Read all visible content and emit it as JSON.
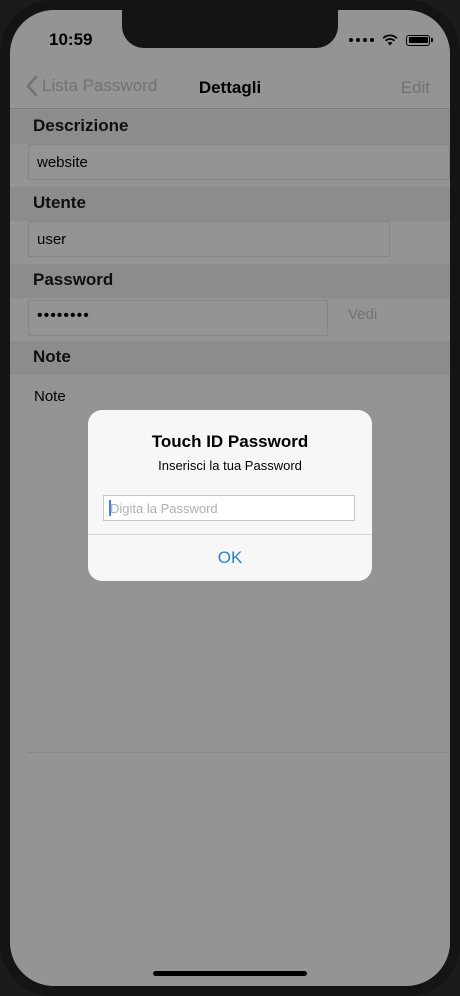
{
  "status": {
    "time": "10:59"
  },
  "nav": {
    "back_label": "Lista Password",
    "title": "Dettagli",
    "edit_label": "Edit"
  },
  "sections": {
    "description": {
      "label": "Descrizione",
      "value": "website"
    },
    "user": {
      "label": "Utente",
      "value": "user"
    },
    "password": {
      "label": "Password",
      "value": "••••••••",
      "show_label": "Vedi"
    },
    "note": {
      "label": "Note",
      "value": "Note"
    }
  },
  "alert": {
    "title": "Touch ID Password",
    "message": "Inserisci la tua Password",
    "input_placeholder": "Digita la Password",
    "ok_label": "OK"
  },
  "colors": {
    "accent": "#2f7fd8",
    "disabled": "#c4c4c4"
  }
}
